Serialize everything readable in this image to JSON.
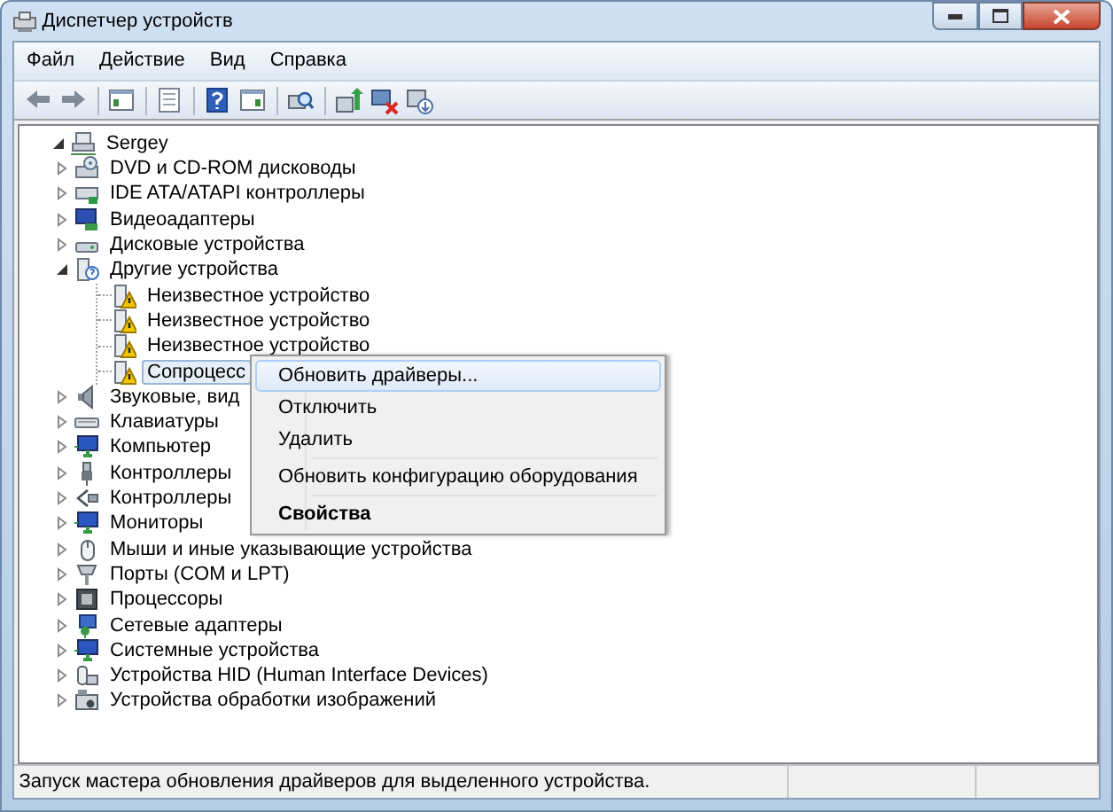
{
  "window": {
    "title": "Диспетчер устройств"
  },
  "menu_bar": [
    {
      "label": "Файл"
    },
    {
      "label": "Действие"
    },
    {
      "label": "Вид"
    },
    {
      "label": "Справка"
    }
  ],
  "toolbar": [
    {
      "kind": "back",
      "disabled": false
    },
    {
      "kind": "forward",
      "disabled": false
    },
    {
      "kind": "separator"
    },
    {
      "kind": "console-tree"
    },
    {
      "kind": "separator"
    },
    {
      "kind": "properties"
    },
    {
      "kind": "separator"
    },
    {
      "kind": "help"
    },
    {
      "kind": "action-pane"
    },
    {
      "kind": "separator"
    },
    {
      "kind": "scan"
    },
    {
      "kind": "separator"
    },
    {
      "kind": "update"
    },
    {
      "kind": "uninstall"
    },
    {
      "kind": "disable"
    }
  ],
  "tree": [
    {
      "label": "Sergey",
      "kind": "computer",
      "expanded": true,
      "selected": false,
      "children": [
        {
          "label": "DVD и CD-ROM дисководы",
          "kind": "disc",
          "expanded": false,
          "selected": false
        },
        {
          "label": "IDE ATA/ATAPI контроллеры",
          "kind": "ide",
          "expanded": false,
          "selected": false
        },
        {
          "label": "Видеоадаптеры",
          "kind": "display",
          "expanded": false,
          "selected": false
        },
        {
          "label": "Дисковые устройства",
          "kind": "disk",
          "expanded": false,
          "selected": false
        },
        {
          "label": "Другие устройства",
          "kind": "unknown",
          "expanded": true,
          "selected": false,
          "children": [
            {
              "label": "Неизвестное устройство",
              "kind": "warning",
              "selected": false
            },
            {
              "label": "Неизвестное устройство",
              "kind": "warning",
              "selected": false
            },
            {
              "label": "Неизвестное устройство",
              "kind": "warning",
              "selected": false
            },
            {
              "label": "Сопроцесс",
              "kind": "warning",
              "selected": true
            }
          ]
        },
        {
          "label": "Звуковые, вид",
          "kind": "sound",
          "expanded": false,
          "selected": false
        },
        {
          "label": "Клавиатуры",
          "kind": "keyboard",
          "expanded": false,
          "selected": false
        },
        {
          "label": "Компьютер",
          "kind": "monitor",
          "expanded": false,
          "selected": false
        },
        {
          "label": "Контроллеры",
          "kind": "usb",
          "expanded": false,
          "selected": false
        },
        {
          "label": "Контроллеры",
          "kind": "storage",
          "expanded": false,
          "selected": false
        },
        {
          "label": "Мониторы",
          "kind": "monitor",
          "expanded": false,
          "selected": false
        },
        {
          "label": "Мыши и иные указывающие устройства",
          "kind": "mouse",
          "expanded": false,
          "selected": false
        },
        {
          "label": "Порты (COM и LPT)",
          "kind": "port",
          "expanded": false,
          "selected": false
        },
        {
          "label": "Процессоры",
          "kind": "cpu",
          "expanded": false,
          "selected": false
        },
        {
          "label": "Сетевые адаптеры",
          "kind": "network",
          "expanded": false,
          "selected": false
        },
        {
          "label": "Системные устройства",
          "kind": "monitor",
          "expanded": false,
          "selected": false
        },
        {
          "label": "Устройства HID (Human Interface Devices)",
          "kind": "hid",
          "expanded": false,
          "selected": false
        },
        {
          "label": "Устройства обработки изображений",
          "kind": "camera",
          "expanded": false,
          "selected": false
        }
      ]
    }
  ],
  "context_menu": [
    {
      "kind": "item",
      "label": "Обновить драйверы...",
      "selected": true,
      "default": false
    },
    {
      "kind": "item",
      "label": "Отключить",
      "selected": false,
      "default": false
    },
    {
      "kind": "item",
      "label": "Удалить",
      "selected": false,
      "default": false
    },
    {
      "kind": "separator"
    },
    {
      "kind": "item",
      "label": "Обновить конфигурацию оборудования",
      "selected": false,
      "default": false
    },
    {
      "kind": "separator"
    },
    {
      "kind": "item",
      "label": "Свойства",
      "selected": false,
      "default": true
    }
  ],
  "status_bar": {
    "text": "Запуск мастера обновления драйверов для выделенного устройства."
  }
}
